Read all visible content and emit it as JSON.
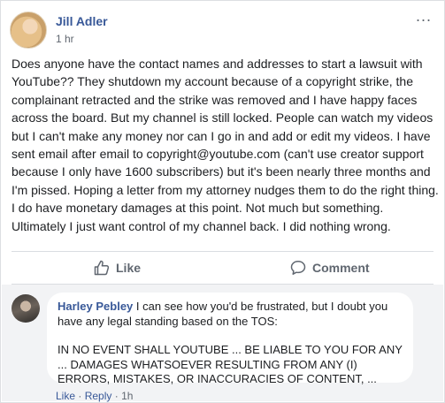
{
  "post": {
    "author": "Jill Adler",
    "time": "1 hr",
    "more_label": "...",
    "text": "Does anyone have the contact names and addresses to start a lawsuit with YouTube?? They shutdown my account because of a copyright strike, the complainant retracted and the strike was removed and I have happy faces across the board. But my channel is still locked. People can watch my videos but I can't make any money nor can I go in and add or edit my videos. I have sent email after email to copyright@youtube.com (can't use creator support because I only have 1600 subscribers) but it's been nearly three months and I'm pissed. Hoping a letter from my attorney nudges them to do the right thing. I do have monetary damages at this point. Not much but something. Ultimately I just want control of my channel back. I did nothing wrong."
  },
  "actions": {
    "like_label": "Like",
    "comment_label": "Comment",
    "like_icon": "thumbs-up-icon",
    "comment_icon": "speech-bubble-icon"
  },
  "comment": {
    "author": "Harley Pebley",
    "text": "I can see how you'd be frustrated, but I doubt you have any legal standing based on the TOS:",
    "quote": "IN NO EVENT SHALL YOUTUBE ... BE LIABLE TO YOU FOR ANY ... DAMAGES WHATSOEVER RESULTING FROM ANY (I) ERRORS, MISTAKES, OR INACCURACIES OF CONTENT, ...",
    "like_label": "Like",
    "reply_label": "Reply",
    "separator": "·",
    "time": "1h"
  },
  "colors": {
    "name_link": "#385898",
    "meta_text": "#606770",
    "comment_background": "#f2f3f5"
  }
}
